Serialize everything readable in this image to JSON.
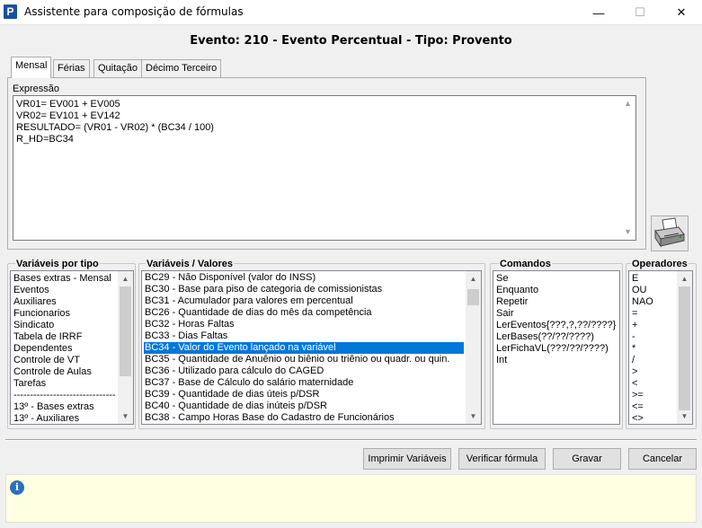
{
  "window": {
    "title": "Assistente para composição de fórmulas",
    "minimize": "—",
    "maximize": "☐",
    "close": "✕"
  },
  "heading": "Evento: 210 - Evento Percentual - Tipo: Provento",
  "tabs": [
    {
      "label": "Mensal",
      "active": true
    },
    {
      "label": "Férias",
      "active": false
    },
    {
      "label": "Quitação",
      "active": false
    },
    {
      "label": "Décimo Terceiro",
      "active": false
    }
  ],
  "expression": {
    "label": "Expressão",
    "text": "VR01= EV001 + EV005\nVR02= EV101 + EV142\nRESULTADO= (VR01 - VR02) * (BC34 / 100)\nR_HD=BC34"
  },
  "groups": {
    "variaveis_tipo": {
      "title": "Variáveis por tipo",
      "items": [
        "Bases extras - Mensal",
        "Eventos",
        "Auxiliares",
        "Funcionarios",
        "Sindicato",
        "Tabela de IRRF",
        "Dependentes",
        "Controle de VT",
        "Controle de Aulas",
        "Tarefas",
        "-------------------------------",
        "13º - Bases extras",
        "13º - Auxiliares"
      ]
    },
    "variaveis_valores": {
      "title": "Variáveis / Valores",
      "items": [
        "BC29 - Não Disponível (valor do INSS)",
        "BC30 - Base para piso de categoria de comissionistas",
        "BC31 - Acumulador para valores em percentual",
        "BC26 - Quantidade de dias do mês da competência",
        "BC32 - Horas Faltas",
        "BC33 - Dias Faltas",
        "BC34 - Valor do Evento lançado na variável",
        "BC35 - Quantidade de Anuênio ou biênio ou triênio ou quadr. ou quin.",
        "BC36 - Utilizado para cálculo do CAGED",
        "BC37 - Base de Cálculo do salário maternidade",
        "BC39 - Quantidade de dias úteis p/DSR",
        "BC40 - Quantidade de dias inúteis p/DSR",
        "BC38 - Campo Horas Base do Cadastro de Funcionários"
      ],
      "selected": "BC34 - Valor do Evento lançado na variável"
    },
    "comandos": {
      "title": "Comandos",
      "items": [
        "Se",
        "Enquanto",
        "Repetir",
        "Sair",
        "LerEventos{???,?,??/????}",
        "LerBases(??/??/????)",
        "LerFichaVL(???/??/????)",
        "Int"
      ]
    },
    "operadores": {
      "title": "Operadores",
      "items": [
        "E",
        "OU",
        "NAO",
        "=",
        "+",
        "-",
        "*",
        "/",
        ">",
        "<",
        ">=",
        "<=",
        "<>"
      ]
    }
  },
  "buttons": {
    "imprimir": "Imprimir Variáveis",
    "verificar": "Verificar fórmula",
    "gravar": "Gravar",
    "cancelar": "Cancelar"
  },
  "status": {
    "icon": "info-icon"
  }
}
